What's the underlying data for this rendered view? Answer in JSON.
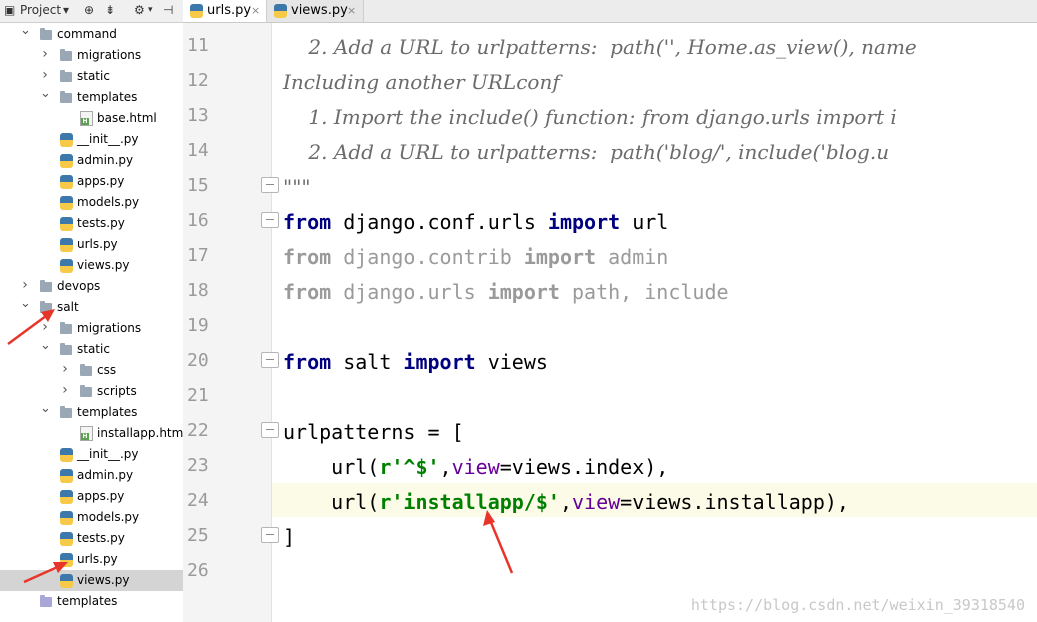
{
  "project_toolbar": {
    "title": "Project",
    "dropdown": "▾",
    "icons": [
      "target-icon",
      "collapse-icon",
      "gear-icon",
      "hide-icon"
    ]
  },
  "tree": [
    {
      "label": "command",
      "type": "folder",
      "expanded": true
    },
    {
      "label": "migrations",
      "type": "folder",
      "expanded": false
    },
    {
      "label": "static",
      "type": "folder",
      "expanded": false
    },
    {
      "label": "templates",
      "type": "folder",
      "expanded": true
    },
    {
      "label": "base.html",
      "type": "html"
    },
    {
      "label": "__init__.py",
      "type": "py"
    },
    {
      "label": "admin.py",
      "type": "py"
    },
    {
      "label": "apps.py",
      "type": "py"
    },
    {
      "label": "models.py",
      "type": "py"
    },
    {
      "label": "tests.py",
      "type": "py"
    },
    {
      "label": "urls.py",
      "type": "py"
    },
    {
      "label": "views.py",
      "type": "py"
    },
    {
      "label": "devops",
      "type": "folder",
      "expanded": false
    },
    {
      "label": "salt",
      "type": "folder",
      "expanded": true
    },
    {
      "label": "migrations",
      "type": "folder",
      "expanded": false
    },
    {
      "label": "static",
      "type": "folder",
      "expanded": true
    },
    {
      "label": "css",
      "type": "folder",
      "expanded": false
    },
    {
      "label": "scripts",
      "type": "folder",
      "expanded": false
    },
    {
      "label": "templates",
      "type": "folder",
      "expanded": true
    },
    {
      "label": "installapp.html",
      "type": "html"
    },
    {
      "label": "__init__.py",
      "type": "py"
    },
    {
      "label": "admin.py",
      "type": "py"
    },
    {
      "label": "apps.py",
      "type": "py"
    },
    {
      "label": "models.py",
      "type": "py"
    },
    {
      "label": "tests.py",
      "type": "py"
    },
    {
      "label": "urls.py",
      "type": "py"
    },
    {
      "label": "views.py",
      "type": "py",
      "selected": true
    },
    {
      "label": "templates",
      "type": "folder-purple"
    }
  ],
  "tabs": [
    {
      "label": "urls.py",
      "active": true,
      "close": "×"
    },
    {
      "label": "views.py",
      "active": false,
      "close": "×"
    }
  ],
  "line_numbers": [
    "11",
    "12",
    "13",
    "14",
    "15",
    "16",
    "17",
    "18",
    "19",
    "20",
    "21",
    "22",
    "23",
    "24",
    "25",
    "26"
  ],
  "code": {
    "l11": "    2. Add a URL to urlpatterns:  path('', Home.as_view(), name",
    "l12": "Including another URLconf",
    "l13": "    1. Import the include() function: from django.urls import i",
    "l14": "    2. Add a URL to urlpatterns:  path('blog/', include('blog.u",
    "l15": "\"\"\"",
    "l16_kw1": "from",
    "l16_mod": " django.conf.urls ",
    "l16_kw2": "import",
    "l16_name": " url",
    "l17_kw1": "from",
    "l17_mod": " django.contrib ",
    "l17_kw2": "import",
    "l17_name": " admin",
    "l18_kw1": "from",
    "l18_mod": " django.urls ",
    "l18_kw2": "import",
    "l18_name": " path, include",
    "l20_kw1": "from",
    "l20_mod": " salt ",
    "l20_kw2": "import",
    "l20_name": " views",
    "l22": "urlpatterns = [",
    "l23_a": "    url(",
    "l23_str": "r'^$'",
    "l23_b": ",",
    "l23_param": "view",
    "l23_c": "=views.index),",
    "l24_a": "    url(",
    "l24_str": "r'installapp/$'",
    "l24_b": ",",
    "l24_param": "view",
    "l24_c": "=views.installapp),",
    "l25": "]"
  },
  "watermark": "https://blog.csdn.net/weixin_39318540",
  "colors": {
    "keyword": "#000080",
    "string": "#008000",
    "param": "#660099",
    "annotation": "#e8352a"
  }
}
